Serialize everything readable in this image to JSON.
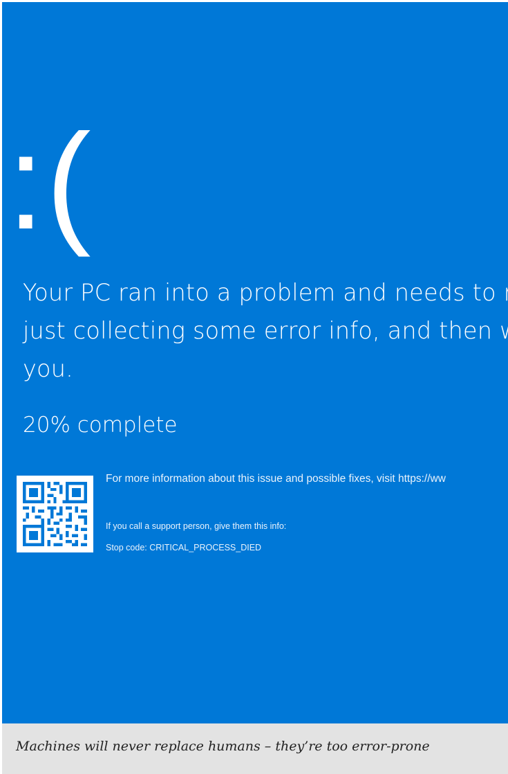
{
  "screen": {
    "background_color": "#0078d7",
    "text_color": "#ffffff",
    "sad_face": ":(",
    "message_lines": [
      "Your PC ran into a problem and needs to r",
      "just collecting some error info, and then w",
      "you."
    ],
    "progress_text": "20% complete",
    "progress_percent": 20,
    "qr_icon": "qr-code-icon",
    "more_info_text": "For more information about this issue and possible fixes, visit https://ww",
    "support_text": "If you call a support person, give them this info:",
    "stop_code_text": "Stop code: CRITICAL_PROCESS_DIED"
  },
  "caption": {
    "background_color": "#e3e3e3",
    "text": "Machines will never replace humans – they’re too error-prone"
  }
}
